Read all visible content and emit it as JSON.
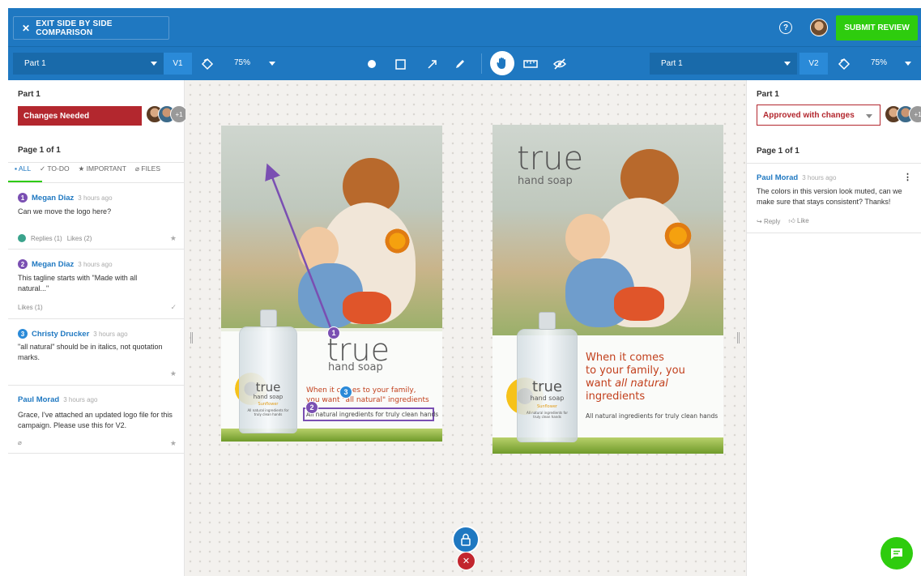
{
  "topbar": {
    "exit_label": "EXIT SIDE BY SIDE COMPARISON",
    "help_icon": "?",
    "submit_label": "SUBMIT REVIEW",
    "accent": "#1f78c1",
    "submit_color": "#2ecc0e"
  },
  "toolbar": {
    "left": {
      "part": "Part 1",
      "version": "V1",
      "zoom": "75%"
    },
    "right": {
      "part": "Part 1",
      "version": "V2",
      "zoom": "75%"
    },
    "tools": [
      "circle-tool-icon",
      "rectangle-tool-icon",
      "arrow-tool-icon",
      "pencil-tool-icon",
      "hand-tool-icon",
      "ruler-icon",
      "hide-annotations-icon"
    ]
  },
  "left_panel": {
    "part_title": "Part 1",
    "status": "Changes Needed",
    "status_color": "#b3272e",
    "reviewers_more": "+1",
    "page_label": "Page 1 of 1",
    "tabs": [
      "ALL",
      "TO-DO",
      "IMPORTANT",
      "FILES"
    ],
    "comments": [
      {
        "num": "1",
        "author": "Megan Diaz",
        "time": "3 hours ago",
        "text": "Can we move the logo here?",
        "footer": "Replies (1)",
        "likes": "Likes (2)"
      },
      {
        "num": "2",
        "author": "Megan Diaz",
        "time": "3 hours ago",
        "text": "This tagline starts with \"Made with all natural...\"",
        "likes": "Likes (1)"
      },
      {
        "num": "3",
        "author": "Christy Drucker",
        "time": "3 hours ago",
        "text": "\"all natural\" should be in italics, not quotation marks."
      },
      {
        "author": "Paul Morad",
        "time": "3 hours ago",
        "text": "Grace, I've attached an updated logo file for this campaign. Please use this for V2."
      }
    ]
  },
  "right_panel": {
    "part_title": "Part 1",
    "status": "Approved with changes",
    "reviewers_more": "+1",
    "page_label": "Page 1 of 1",
    "comments": [
      {
        "author": "Paul Morad",
        "time": "3 hours ago",
        "text": "The colors in this version look muted, can we make sure that stays consistent? Thanks!",
        "reply": "Reply",
        "like": "Like"
      }
    ]
  },
  "ad_v1": {
    "logo": "true",
    "logo_sub": "hand soap",
    "tagline_line1": "When it comes to your family,",
    "tagline_line2": "you want \"all natural\" ingredients",
    "copy": "All natural ingredients for truly clean hands",
    "bottle_logo": "true",
    "bottle_sub": "hand soap",
    "bottle_variant": "Sunflower",
    "bottle_small": "All natural ingredients for truly clean hands",
    "pins": [
      "1",
      "2",
      "3"
    ]
  },
  "ad_v2": {
    "logo": "true",
    "logo_sub": "hand soap",
    "tagline_line1": "When it comes",
    "tagline_line2": "to your family, you",
    "tagline_line3_pre": "want ",
    "tagline_line3_em": "all natural",
    "tagline_line4": "ingredients",
    "copy": "All natural ingredients for truly clean hands",
    "bottle_logo": "true",
    "bottle_sub": "hand soap",
    "bottle_variant": "Sunflower",
    "bottle_small": "All natural ingredients for truly clean hands"
  }
}
